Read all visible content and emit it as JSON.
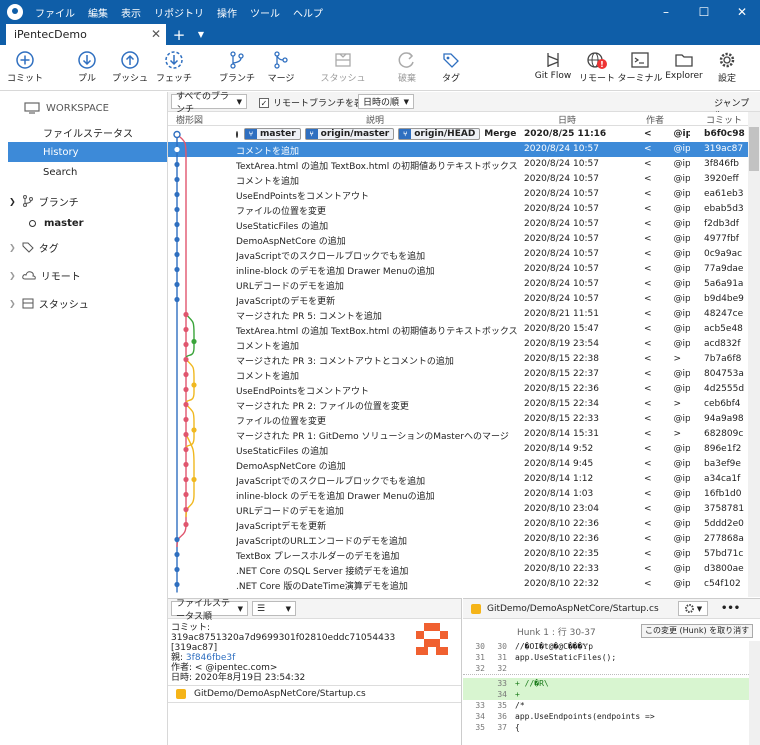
{
  "titlebar": {
    "menus": [
      "ファイル",
      "編集",
      "表示",
      "リポジトリ",
      "操作",
      "ツール",
      "ヘルプ"
    ],
    "minimize": "–",
    "maximize": "☐",
    "close": "✕"
  },
  "tabs": {
    "active": "iPentecDemo",
    "close": "✕",
    "add": "+",
    "menu": "▼"
  },
  "toolbar": {
    "commit": "コミット",
    "pull": "プル",
    "push": "プッシュ",
    "fetch": "フェッチ",
    "branch": "ブランチ",
    "merge": "マージ",
    "stash": "スタッシュ",
    "discard": "破棄",
    "tag": "タグ",
    "gitflow": "Git Flow",
    "remote": "リモート",
    "terminal": "ターミナル",
    "explorer": "Explorer",
    "settings": "設定"
  },
  "sidebar": {
    "workspace": "WORKSPACE",
    "file_status": "ファイルステータス",
    "history": "History",
    "search": "Search",
    "branches": "ブランチ",
    "master": "master",
    "tags": "タグ",
    "remotes": "リモート",
    "stashes": "スタッシュ"
  },
  "filterbar": {
    "branch_filter": "すべてのブランチ",
    "show_remote": "リモートブランチを表示",
    "sort": "日時の順",
    "jump": "ジャンプ先:"
  },
  "columns": {
    "graph": "樹形図",
    "description": "説明",
    "date": "日時",
    "author": "作者",
    "commit": "コミット"
  },
  "head_row": {
    "badges": [
      "master",
      "origin/master",
      "origin/HEAD"
    ],
    "message": "Merge br",
    "date": "2020/8/25 11:16",
    "author": "<",
    "author2": "@ipe",
    "hash": "b6f0c98"
  },
  "commits": [
    {
      "msg": "コメントを追加",
      "date": "2020/8/24 10:57",
      "a": "<",
      "b": "@ipe",
      "hash": "319ac87"
    },
    {
      "msg": "TextArea.html の追加 TextBox.html の初期値ありテキストボックスの追加",
      "date": "2020/8/24 10:57",
      "a": "<",
      "b": "@ipe",
      "hash": "3f846fb"
    },
    {
      "msg": "コメントを追加",
      "date": "2020/8/24 10:57",
      "a": "<",
      "b": "@ipe",
      "hash": "3920eff"
    },
    {
      "msg": "UseEndPointsをコメントアウト",
      "date": "2020/8/24 10:57",
      "a": "<",
      "b": "@ipe",
      "hash": "ea61eb3"
    },
    {
      "msg": "ファイルの位置を変更",
      "date": "2020/8/24 10:57",
      "a": "<",
      "b": "@ipe",
      "hash": "ebab5d3"
    },
    {
      "msg": "UseStaticFiles の追加",
      "date": "2020/8/24 10:57",
      "a": "<",
      "b": "@ipe",
      "hash": "f2db3df"
    },
    {
      "msg": "DemoAspNetCore の追加",
      "date": "2020/8/24 10:57",
      "a": "<",
      "b": "@ipe",
      "hash": "4977fbf"
    },
    {
      "msg": "JavaScriptでのスクロールブロックでもを追加",
      "date": "2020/8/24 10:57",
      "a": "<",
      "b": "@ipe",
      "hash": "0c9a9ac"
    },
    {
      "msg": "inline-block のデモを追加 Drawer Menuの追加",
      "date": "2020/8/24 10:57",
      "a": "<",
      "b": "@ipe",
      "hash": "77a9dae"
    },
    {
      "msg": "URLデコードのデモを追加",
      "date": "2020/8/24 10:57",
      "a": "<",
      "b": "@ipe",
      "hash": "5a6a91a"
    },
    {
      "msg": "JavaScriptのデモを更新",
      "date": "2020/8/24 10:57",
      "a": "<",
      "b": "@ipe",
      "hash": "b9d4be9"
    },
    {
      "msg": "マージされた PR 5: コメントを追加",
      "date": "2020/8/21 11:51",
      "a": "<",
      "b": "@ipe",
      "hash": "48247ce"
    },
    {
      "msg": "TextArea.html の追加 TextBox.html の初期値ありテキストボックスの追加",
      "date": "2020/8/20 15:47",
      "a": "<",
      "b": "@ipe",
      "hash": "acb5e48"
    },
    {
      "msg": "コメントを追加",
      "date": "2020/8/19 23:54",
      "a": "<",
      "b": "@ipe",
      "hash": "acd832f"
    },
    {
      "msg": "マージされた PR 3: コメントアウトとコメントの追加",
      "date": "2020/8/15 22:38",
      "a": "<",
      "b": ">",
      "hash": "7b7a6f8"
    },
    {
      "msg": "コメントを追加",
      "date": "2020/8/15 22:37",
      "a": "<",
      "b": "@ipe",
      "hash": "804753a"
    },
    {
      "msg": "UseEndPointsをコメントアウト",
      "date": "2020/8/15 22:36",
      "a": "<",
      "b": "@ipe",
      "hash": "4d2555d"
    },
    {
      "msg": "マージされた PR 2: ファイルの位置を変更",
      "date": "2020/8/15 22:34",
      "a": "<",
      "b": ">",
      "hash": "ceb6bf4"
    },
    {
      "msg": "ファイルの位置を変更",
      "date": "2020/8/15 22:33",
      "a": "<",
      "b": "@ipe",
      "hash": "94a9a98"
    },
    {
      "msg": "マージされた PR 1: GitDemo ソリューションのMasterへのマージ",
      "date": "2020/8/14 15:31",
      "a": "<",
      "b": ">",
      "hash": "682809c"
    },
    {
      "msg": "UseStaticFiles の追加",
      "date": "2020/8/14 9:52",
      "a": "<",
      "b": "@ipe",
      "hash": "896e1f2"
    },
    {
      "msg": "DemoAspNetCore の追加",
      "date": "2020/8/14 9:45",
      "a": "<",
      "b": "@ipe",
      "hash": "ba3ef9e"
    },
    {
      "msg": "JavaScriptでのスクロールブロックでもを追加",
      "date": "2020/8/14 1:12",
      "a": "<",
      "b": "@ipe",
      "hash": "a34ca1f"
    },
    {
      "msg": "inline-block のデモを追加 Drawer Menuの追加",
      "date": "2020/8/14 1:03",
      "a": "<",
      "b": "@ipe",
      "hash": "16fb1d0"
    },
    {
      "msg": "URLデコードのデモを追加",
      "date": "2020/8/10 23:04",
      "a": "<",
      "b": "@ipe",
      "hash": "3758781"
    },
    {
      "msg": "JavaScriptデモを更新",
      "date": "2020/8/10 22:36",
      "a": "<",
      "b": "@ipe",
      "hash": "5ddd2e0"
    },
    {
      "msg": "JavaScriptのURLエンコードのデモを追加",
      "date": "2020/8/10 22:36",
      "a": "<",
      "b": "@ipe",
      "hash": "277868a"
    },
    {
      "msg": "TextBox プレースホルダーのデモを追加",
      "date": "2020/8/10 22:35",
      "a": "<",
      "b": "@ipe",
      "hash": "57bd71c"
    },
    {
      "msg": ".NET Core のSQL Server 接続デモを追加",
      "date": "2020/8/10 22:33",
      "a": "<",
      "b": "@ipe",
      "hash": "d3800ae"
    },
    {
      "msg": ".NET Core 版のDateTime演算デモを追加",
      "date": "2020/8/10 22:32",
      "a": "<",
      "b": "@ipe",
      "hash": "c54f102"
    }
  ],
  "detail": {
    "sort": "ファイルステータス順",
    "menu_icon": "☰",
    "commit_label": "コミット:",
    "commit_full": "319ac8751320a7d9699301f02810eddc71054433",
    "commit_short": "[319ac87]",
    "parent_label": "親:",
    "parent": "3f846fbe3f",
    "author_label": "作者:",
    "author": "<        @ipentec.com>",
    "date_label": "日時:",
    "date": "2020年8月19日 23:54:32",
    "file": "GitDemo/DemoAspNetCore/Startup.cs"
  },
  "diff": {
    "file": "GitDemo/DemoAspNetCore/Startup.cs",
    "more": "•••",
    "hunk": "Hunk 1 : 行 30-37",
    "discard_hunk": "この変更 (Hunk) を取り消す",
    "lines": [
      {
        "o": "30",
        "n": "30",
        "t": "        //�OI�t@�@C���Ɏp",
        "k": " "
      },
      {
        "o": "31",
        "n": "31",
        "t": "        app.UseStaticFiles();",
        "k": " "
      },
      {
        "o": "32",
        "n": "32",
        "t": "",
        "k": " "
      },
      {
        "o": "",
        "n": "33",
        "t": "+       //�R\\",
        "k": "+"
      },
      {
        "o": "",
        "n": "34",
        "t": "+",
        "k": "+"
      },
      {
        "o": "33",
        "n": "35",
        "t": "        /*",
        "k": " "
      },
      {
        "o": "34",
        "n": "36",
        "t": "        app.UseEndpoints(endpoints =>",
        "k": " "
      },
      {
        "o": "35",
        "n": "37",
        "t": "        {",
        "k": " "
      }
    ]
  }
}
